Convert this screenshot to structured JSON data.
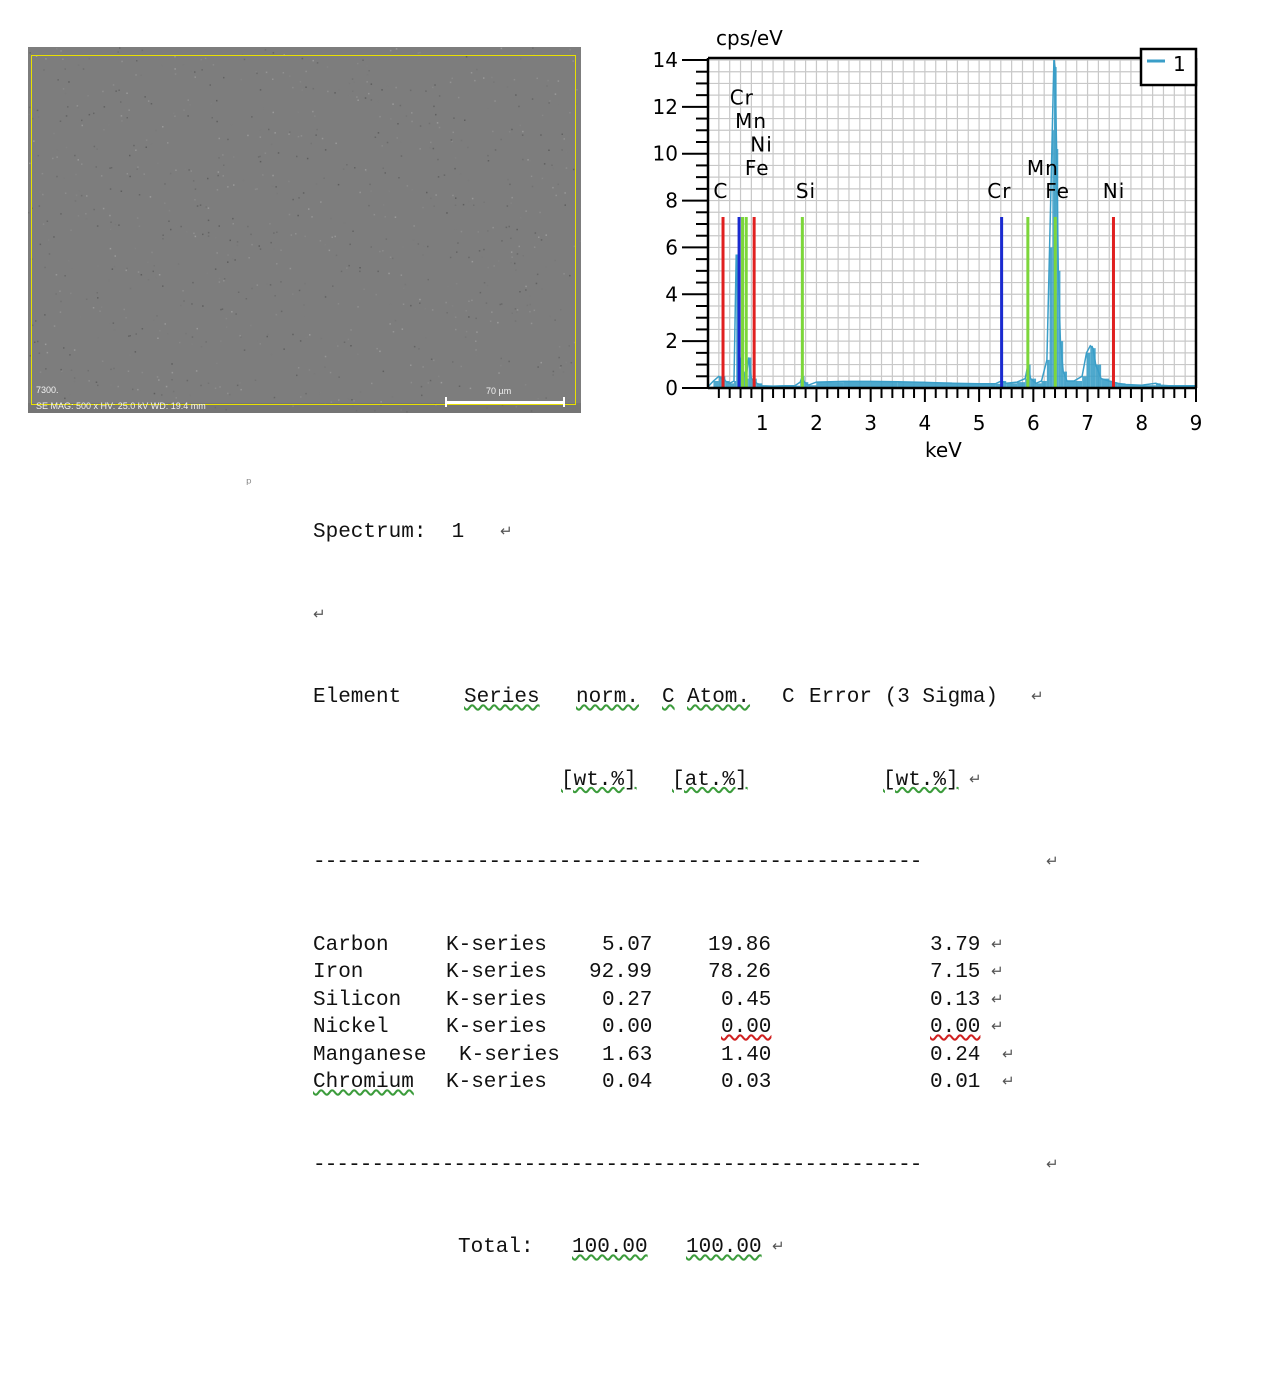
{
  "sem": {
    "sample_id": "7300.",
    "info": "SE  MAG: 500 x  HV: 25.0 kV  WD: 19.4 mm",
    "scale_label": "70 µm"
  },
  "chart_data": {
    "type": "line",
    "title": "",
    "xlabel": "keV",
    "ylabel": "cps/eV",
    "xlim": [
      0,
      9
    ],
    "ylim": [
      0,
      14
    ],
    "xticks": [
      1,
      2,
      3,
      4,
      5,
      6,
      7,
      8,
      9
    ],
    "yticks": [
      0,
      2,
      4,
      6,
      8,
      10,
      12,
      14
    ],
    "grid": true,
    "legend": {
      "position": "top-right",
      "entries": [
        "1"
      ]
    },
    "series": [
      {
        "name": "1",
        "color": "#3a9ec8",
        "x": [
          0.0,
          0.1,
          0.2,
          0.25,
          0.28,
          0.32,
          0.4,
          0.48,
          0.52,
          0.58,
          0.64,
          0.7,
          0.75,
          0.8,
          0.9,
          1.0,
          1.2,
          1.4,
          1.6,
          1.7,
          1.74,
          1.78,
          1.85,
          2.0,
          2.5,
          3.0,
          3.5,
          4.0,
          4.5,
          5.0,
          5.3,
          5.41,
          5.5,
          5.7,
          5.85,
          5.9,
          5.95,
          6.05,
          6.15,
          6.25,
          6.3,
          6.35,
          6.38,
          6.4,
          6.43,
          6.46,
          6.5,
          6.55,
          6.62,
          6.75,
          6.9,
          6.98,
          7.05,
          7.1,
          7.15,
          7.25,
          7.4,
          7.48,
          7.55,
          7.7,
          8.0,
          8.26,
          8.35,
          8.5,
          8.8,
          9.0
        ],
        "y": [
          0.05,
          0.3,
          0.5,
          0.4,
          0.5,
          0.3,
          0.2,
          0.3,
          5.7,
          1.3,
          0.7,
          0.4,
          1.3,
          0.4,
          0.2,
          0.1,
          0.08,
          0.1,
          0.1,
          0.25,
          0.5,
          0.25,
          0.12,
          0.25,
          0.28,
          0.28,
          0.27,
          0.24,
          0.2,
          0.18,
          0.18,
          0.3,
          0.2,
          0.25,
          0.4,
          1.0,
          0.4,
          0.2,
          0.3,
          1.2,
          6.0,
          11.0,
          14.0,
          13.7,
          10.2,
          5.0,
          2.0,
          0.7,
          0.3,
          0.3,
          0.5,
          1.5,
          1.8,
          1.7,
          1.0,
          0.4,
          0.3,
          0.25,
          0.2,
          0.15,
          0.12,
          0.2,
          0.12,
          0.1,
          0.1,
          0.1
        ]
      }
    ],
    "element_markers": [
      {
        "element": "C",
        "energy": 0.277,
        "color": "#e02020"
      },
      {
        "element": "Cr",
        "energy": 0.573,
        "color": "#1a2ad0"
      },
      {
        "element": "Mn",
        "energy": 0.637,
        "color": "#7cd63a"
      },
      {
        "element": "Ni",
        "energy": 0.851,
        "color": "#e02020"
      },
      {
        "element": "Fe",
        "energy": 0.705,
        "color": "#7cd63a"
      },
      {
        "element": "Si",
        "energy": 1.74,
        "color": "#7cd63a"
      },
      {
        "element": "Cr",
        "energy": 5.415,
        "color": "#1a2ad0"
      },
      {
        "element": "Mn",
        "energy": 5.899,
        "color": "#7cd63a"
      },
      {
        "element": "Fe",
        "energy": 6.404,
        "color": "#7cd63a"
      },
      {
        "element": "Ni",
        "energy": 7.478,
        "color": "#e02020"
      }
    ],
    "marker_labels": [
      {
        "text": "Cr",
        "energy": 0.4,
        "y": 12.1
      },
      {
        "text": "Mn",
        "energy": 0.5,
        "y": 11.1
      },
      {
        "text": "Ni",
        "energy": 0.78,
        "y": 10.1
      },
      {
        "text": "Fe",
        "energy": 0.68,
        "y": 9.1
      },
      {
        "text": "C",
        "energy": 0.1,
        "y": 8.1
      },
      {
        "text": "Si",
        "energy": 1.62,
        "y": 8.1
      },
      {
        "text": "Mn",
        "energy": 5.88,
        "y": 9.1
      },
      {
        "text": "Cr",
        "energy": 5.15,
        "y": 8.1
      },
      {
        "text": "Fe",
        "energy": 6.22,
        "y": 8.1
      },
      {
        "text": "Ni",
        "energy": 7.28,
        "y": 8.1
      }
    ]
  },
  "report": {
    "spectrum_line": "Spectrum:  1",
    "header_element": "Element",
    "header_series": "Series",
    "header_norm": "norm.",
    "header_c1": "C",
    "header_atom": "Atom.",
    "header_c2": "C",
    "header_error": "Error (3 Sigma)",
    "unit_wt": "[wt.%]",
    "unit_at": "[at.%]",
    "unit_err": "[wt.%]",
    "divider": "----------------------------------------------------",
    "rows": [
      {
        "element": "Carbon",
        "series": "K-series",
        "norm": "5.07",
        "atom": "19.86",
        "error": "3.79"
      },
      {
        "element": "Iron",
        "series": "K-series",
        "norm": "92.99",
        "atom": "78.26",
        "error": "7.15"
      },
      {
        "element": "Silicon",
        "series": "K-series",
        "norm": "0.27",
        "atom": "0.45",
        "error": "0.13"
      },
      {
        "element": "Nickel",
        "series": "K-series",
        "norm": "0.00",
        "atom": "0.00",
        "error": "0.00"
      },
      {
        "element": "Manganese",
        "series": "K-series",
        "norm": "1.63",
        "atom": "1.40",
        "error": "0.24"
      },
      {
        "element": "Chromium",
        "series": "K-series",
        "norm": "0.04",
        "atom": "0.03",
        "error": "0.01"
      }
    ],
    "total_label": "Total:",
    "total_norm": "100.00",
    "total_atom": "100.00",
    "return_mark": "↵"
  }
}
